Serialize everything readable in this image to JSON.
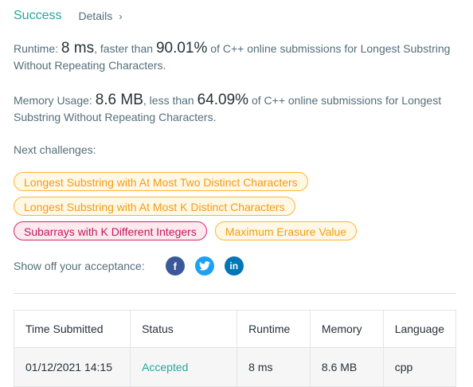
{
  "header": {
    "status": "Success",
    "details_label": "Details",
    "details_chevron": "›"
  },
  "runtime": {
    "label": "Runtime:",
    "value": "8 ms",
    "comparison": ", faster than",
    "percentile": "90.01%",
    "suffix": "of C++ online submissions for Longest Substring Without Repeating Characters."
  },
  "memory": {
    "label": "Memory Usage:",
    "value": "8.6 MB",
    "comparison": ", less than",
    "percentile": "64.09%",
    "suffix": "of C++ online submissions for Longest Substring Without Repeating Characters."
  },
  "next_challenges": {
    "label": "Next challenges:",
    "items": [
      {
        "label": "Longest Substring with At Most Two Distinct Characters",
        "difficulty": "medium"
      },
      {
        "label": "Longest Substring with At Most K Distinct Characters",
        "difficulty": "medium"
      },
      {
        "label": "Subarrays with K Different Integers",
        "difficulty": "hard"
      },
      {
        "label": "Maximum Erasure Value",
        "difficulty": "medium"
      }
    ]
  },
  "share": {
    "label": "Show off your acceptance:",
    "icons": [
      {
        "name": "facebook-icon",
        "glyph": "f",
        "color": "#3b5998"
      },
      {
        "name": "twitter-icon",
        "glyph": "t",
        "color": "#1da1f2"
      },
      {
        "name": "linkedin-icon",
        "glyph": "in",
        "color": "#0077b5"
      }
    ]
  },
  "submissions": {
    "headers": [
      "Time Submitted",
      "Status",
      "Runtime",
      "Memory",
      "Language"
    ],
    "rows": [
      [
        "01/12/2021 14:15",
        "Accepted",
        "8 ms",
        "8.6 MB",
        "cpp"
      ]
    ]
  },
  "colors": {
    "success": "#26a69a",
    "medium_tag": "#f39c12",
    "hard_tag": "#c2185b"
  }
}
